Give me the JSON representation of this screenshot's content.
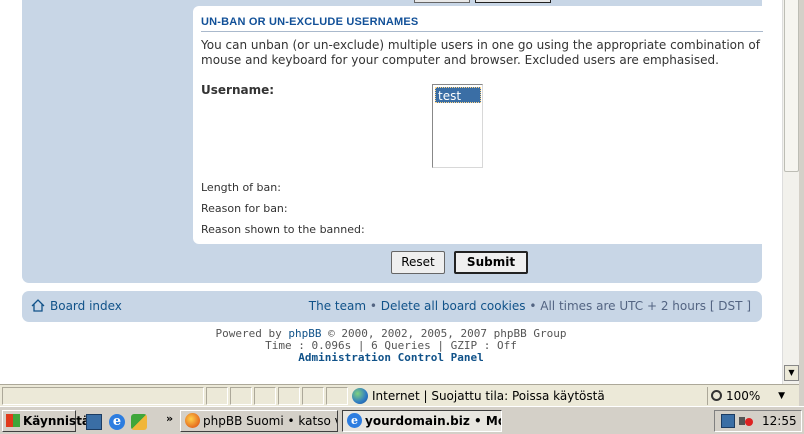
{
  "fieldset": {
    "legend": "UN-BAN OR UN-EXCLUDE USERNAMES",
    "description": "You can unban (or un-exclude) multiple users in one go using the appropriate combination of mouse and keyboard for your computer and browser. Excluded users are emphasised.",
    "username_label": "Username:",
    "username_options": [
      "test"
    ],
    "length_label": "Length of ban:",
    "reason_label": "Reason for ban:",
    "reason_shown_label": "Reason shown to the banned:"
  },
  "buttons": {
    "reset": "Reset",
    "submit": "Submit"
  },
  "navbar": {
    "board_index": "Board index",
    "team": "The team",
    "sep": " • ",
    "delete_cookies": "Delete all board cookies",
    "times": "All times are UTC + 2 hours [ DST ]"
  },
  "footer": {
    "powered_prefix": "Powered by ",
    "phpbb": "phpBB",
    "powered_suffix": " © 2000, 2002, 2005, 2007 phpBB Group",
    "stats": "Time : 0.096s | 6 Queries | GZIP : Off",
    "acp": "Administration Control Panel"
  },
  "statusbar": {
    "zone": "Internet | Suojattu tila: Poissa käytöstä",
    "zoom": "100%"
  },
  "taskbar": {
    "start": "Käynnistä",
    "more": "»",
    "task_firefox": "phpBB Suomi • katso vi...",
    "task_ie": "yourdomain.biz • Mod...",
    "clock": "12:55"
  }
}
